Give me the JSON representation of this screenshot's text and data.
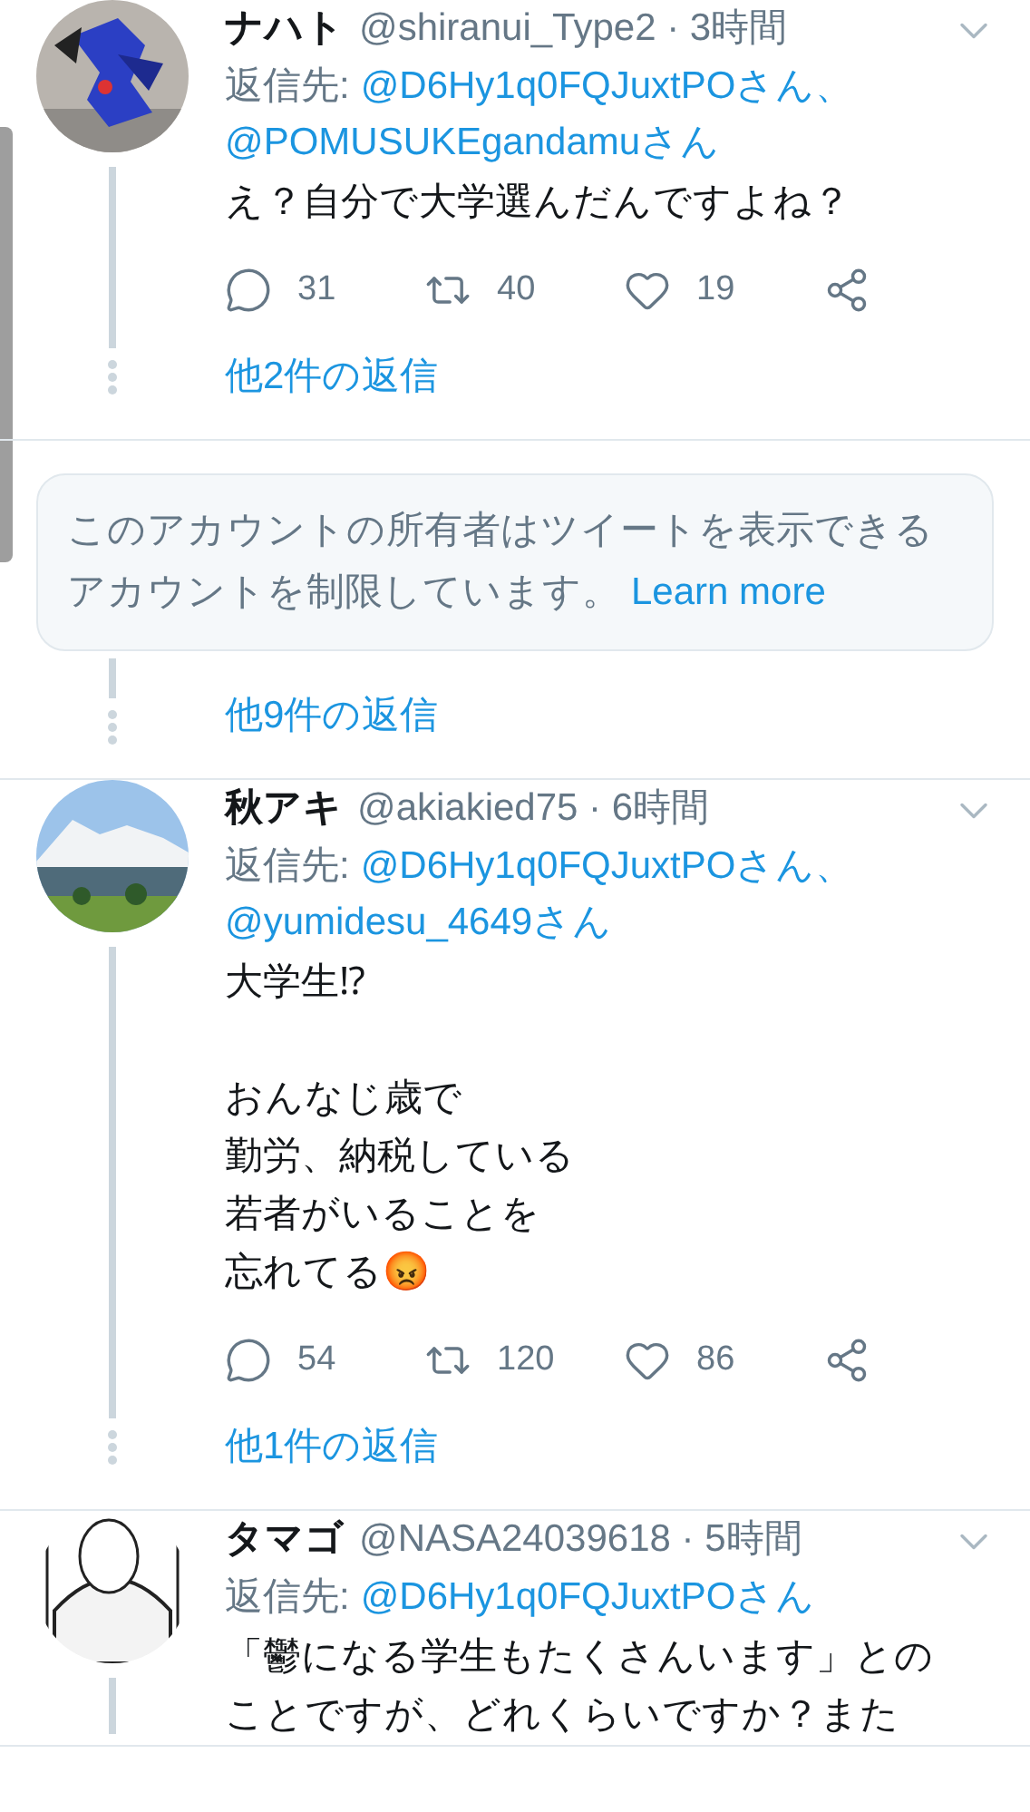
{
  "feed": [
    {
      "kind": "tweet",
      "name": "ナハト",
      "meta": "@shiranui_Type2 · 3時間",
      "reply_label": "返信先:",
      "mentions": [
        "@D6Hy1q0FQJuxtPOさん、",
        "@POMUSUKEgandamuさん"
      ],
      "body": [
        [
          "え？自分で大学選んだんですよね？"
        ]
      ],
      "stats": {
        "replies": "31",
        "retweets": "40",
        "likes": "19"
      },
      "more_replies": "他2件の返信"
    },
    {
      "kind": "notice",
      "text": "このアカウントの所有者はツイートを表示できるアカウントを制限しています。",
      "link": "Learn more",
      "more_replies": "他9件の返信"
    },
    {
      "kind": "tweet",
      "name": "秋アキ",
      "meta": "@akiakied75 · 6時間",
      "reply_label": "返信先:",
      "mentions": [
        "@D6Hy1q0FQJuxtPOさん、",
        "@yumidesu_4649さん"
      ],
      "body": [
        [
          "大学生⁉"
        ],
        [
          "おんなじ歳で",
          "勤労、納税している",
          "若者がいることを",
          "忘れてる😡"
        ]
      ],
      "stats": {
        "replies": "54",
        "retweets": "120",
        "likes": "86"
      },
      "more_replies": "他1件の返信"
    },
    {
      "kind": "tweet",
      "name": "タマゴ",
      "meta": "@NASA24039618 · 5時間",
      "reply_label": "返信先:",
      "mentions": [
        "@D6Hy1q0FQJuxtPOさん"
      ],
      "body": [
        [
          "「鬱になる学生もたくさんいます」との",
          "ことですが、どれくらいですか？また"
        ]
      ]
    }
  ]
}
